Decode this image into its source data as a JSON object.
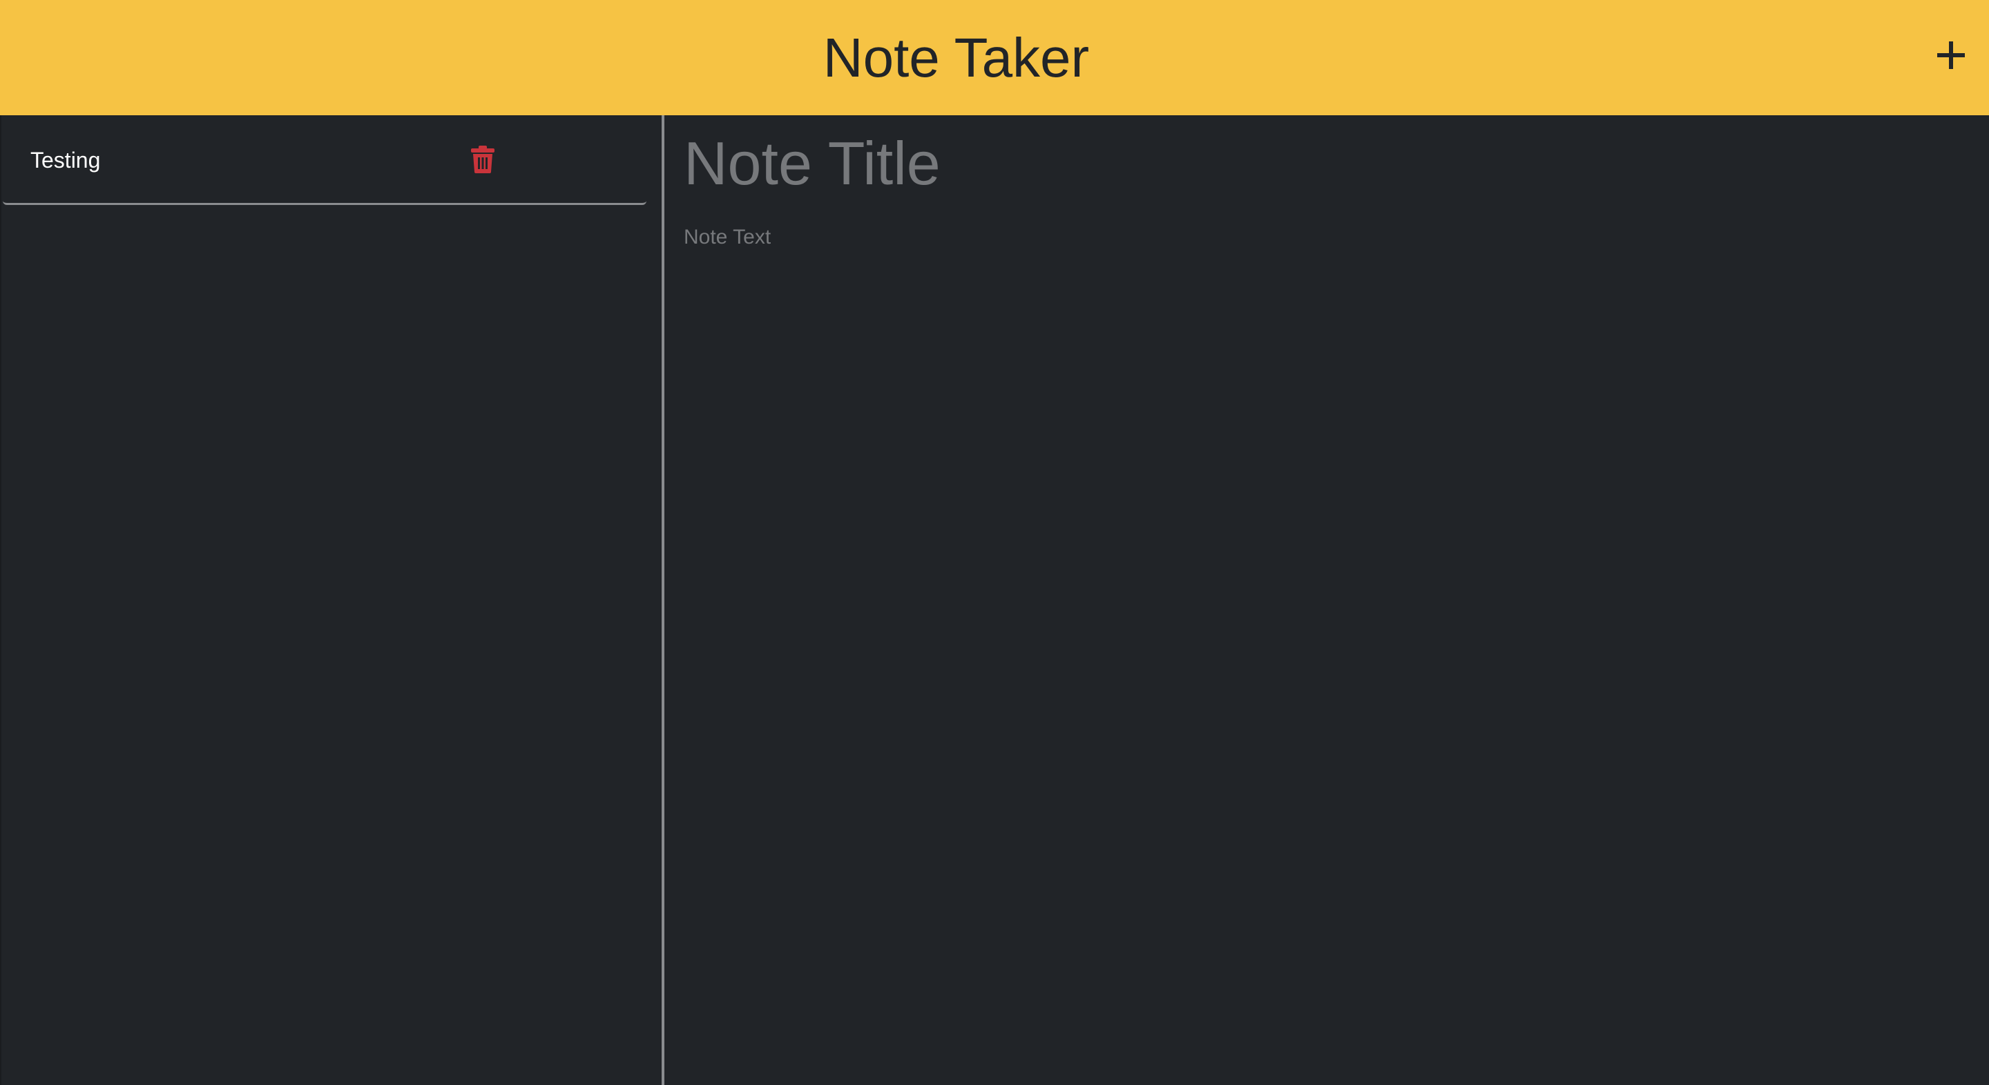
{
  "app": {
    "title": "Note Taker",
    "new_note_icon": "plus-icon"
  },
  "notes": [
    {
      "title": "Testing",
      "delete_icon": "trash-icon",
      "delete_color": "#c9343b"
    }
  ],
  "editor": {
    "title_placeholder": "Note Title",
    "text_placeholder": "Note Text"
  },
  "colors": {
    "navbar": "#f6c344",
    "background": "#212428",
    "accent_delete": "#c9343b"
  }
}
